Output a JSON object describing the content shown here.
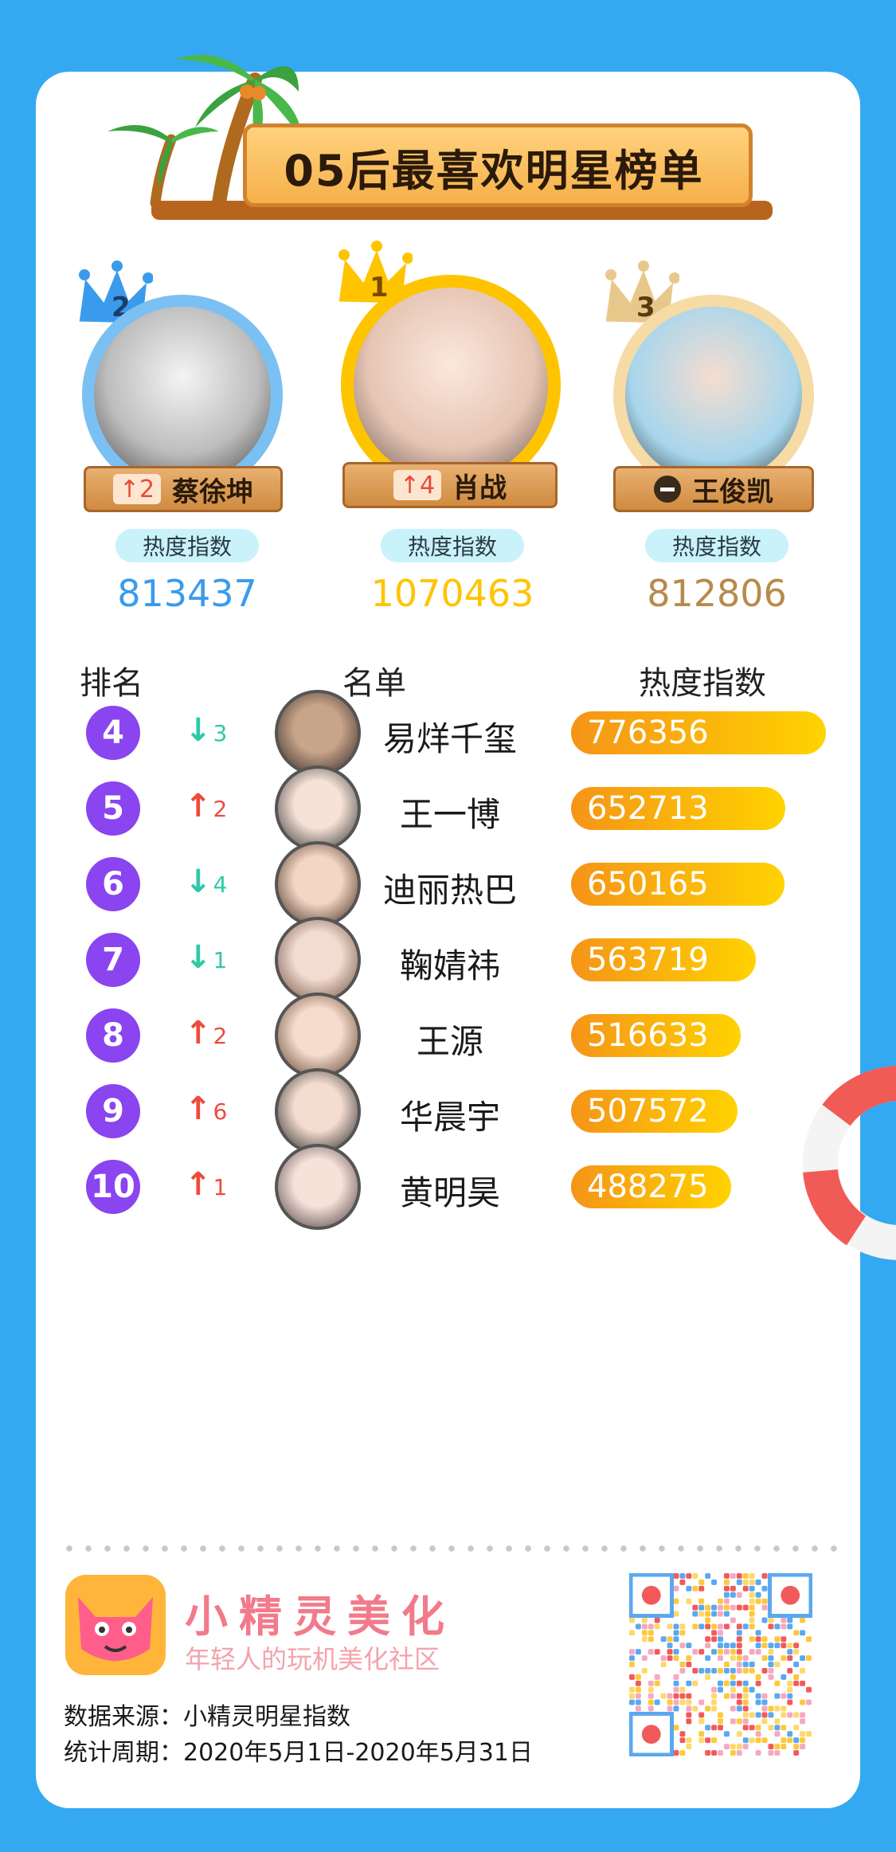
{
  "title": "05后最喜欢明星榜单",
  "podium": [
    {
      "place": "2",
      "name": "蔡徐坤",
      "change_dir": "up",
      "change": "2",
      "heat_label": "热度指数",
      "score": "813437",
      "color": "#3a9bec"
    },
    {
      "place": "1",
      "name": "肖战",
      "change_dir": "up",
      "change": "4",
      "heat_label": "热度指数",
      "score": "1070463",
      "color": "#ffc400"
    },
    {
      "place": "3",
      "name": "王俊凯",
      "change_dir": "same",
      "change": "",
      "heat_label": "热度指数",
      "score": "812806",
      "color": "#b88a4a"
    }
  ],
  "table_headers": {
    "rank": "排名",
    "name": "名单",
    "score": "热度指数"
  },
  "chart_data": {
    "type": "bar",
    "orientation": "horizontal",
    "title": "05后最喜欢明星榜单",
    "categories": [
      "易烊千玺",
      "王一博",
      "迪丽热巴",
      "鞠婧祎",
      "王源",
      "华晨宇",
      "黄明昊"
    ],
    "ranks": [
      "4",
      "5",
      "6",
      "7",
      "8",
      "9",
      "10"
    ],
    "changes": [
      {
        "dir": "down",
        "value": "3"
      },
      {
        "dir": "up",
        "value": "2"
      },
      {
        "dir": "down",
        "value": "4"
      },
      {
        "dir": "down",
        "value": "1"
      },
      {
        "dir": "up",
        "value": "2"
      },
      {
        "dir": "up",
        "value": "6"
      },
      {
        "dir": "up",
        "value": "1"
      }
    ],
    "values": [
      776356,
      652713,
      650165,
      563719,
      516633,
      507572,
      488275
    ],
    "xlim": [
      0,
      776356
    ]
  },
  "footer": {
    "brand": "小精灵美化",
    "tagline": "年轻人的玩机美化社区",
    "source": "数据来源：小精灵明星指数",
    "period": "统计周期：2020年5月1日-2020年5月31日"
  },
  "colors": {
    "background": "#35a8f2",
    "rank_badge": "#8a44f0",
    "up": "#ee4b3c",
    "down": "#2fc9a8",
    "bar_start": "#f59418",
    "bar_end": "#ffd300"
  }
}
